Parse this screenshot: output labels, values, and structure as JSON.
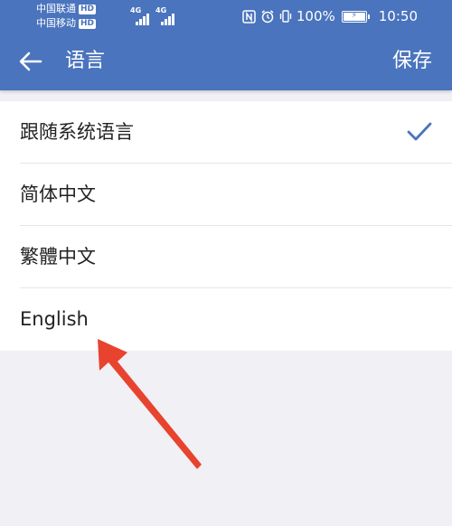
{
  "status_bar": {
    "carrier1": "中国联通",
    "carrier2": "中国移动",
    "hd_badge": "HD",
    "network1": "4G",
    "network2": "4G",
    "battery_percent": "100%",
    "battery_level": 1.0,
    "time": "10:50",
    "icons": [
      "nfc-icon",
      "alarm-icon",
      "vibrate-icon",
      "battery-icon"
    ]
  },
  "app_bar": {
    "back_icon": "back-arrow-icon",
    "title": "语言",
    "save_label": "保存"
  },
  "languages": {
    "items": [
      {
        "label": "跟随系统语言",
        "selected": true
      },
      {
        "label": "简体中文",
        "selected": false
      },
      {
        "label": "繁體中文",
        "selected": false
      },
      {
        "label": "English",
        "selected": false
      }
    ]
  },
  "colors": {
    "brand": "#4a74bd",
    "check": "#4a74bd",
    "annotation": "#e8432e",
    "background": "#f0f0f5"
  }
}
